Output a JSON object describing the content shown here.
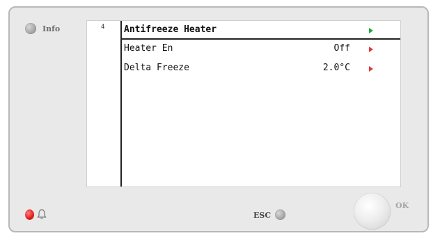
{
  "panel": {
    "info_label": "Info",
    "esc_label": "ESC",
    "ok_label": "OK",
    "alarm_led_color": "#e01c1c"
  },
  "screen": {
    "page_number": "4",
    "title": "Antifreeze Heater",
    "title_arrow_color": "#27a83a",
    "item_arrow_color": "#e03a3a",
    "items": [
      {
        "label": "Heater En",
        "value": "Off"
      },
      {
        "label": "Delta Freeze",
        "value": "2.0°C"
      }
    ]
  },
  "icons": {
    "info": "info-button-icon",
    "bell": "bell-icon",
    "menu_arrow": "arrow-right-icon"
  }
}
